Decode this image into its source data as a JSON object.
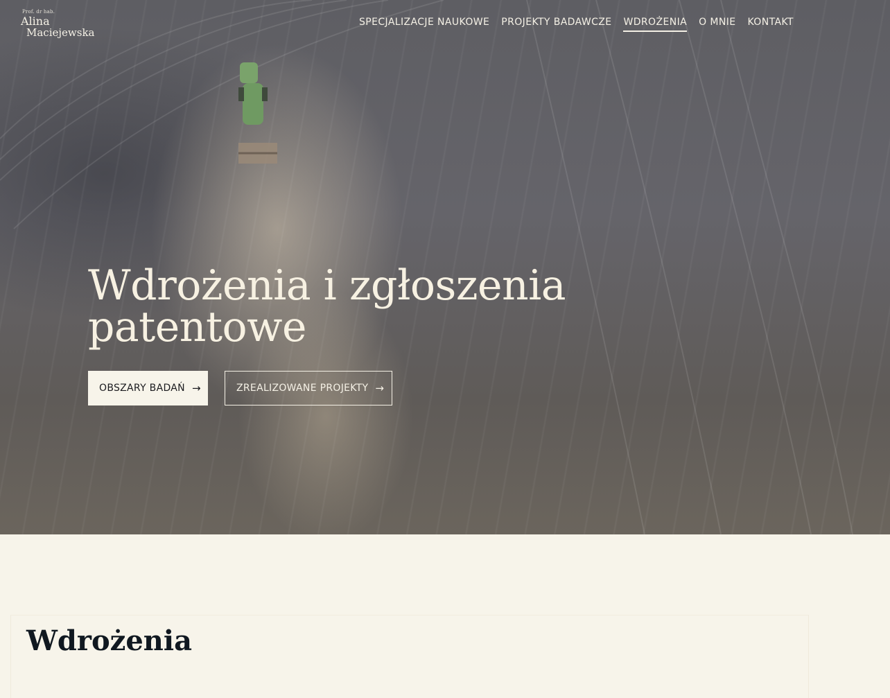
{
  "logo": {
    "prefix": "Prof. dr hab.",
    "first_name": "Alina",
    "last_name": "Maciejewska"
  },
  "nav": {
    "items": [
      {
        "label": "SPECJALIZACJE NAUKOWE",
        "active": false
      },
      {
        "label": "PROJEKTY BADAWCZE",
        "active": false
      },
      {
        "label": "WDROŻENIA",
        "active": true
      },
      {
        "label": "O MNIE",
        "active": false
      },
      {
        "label": "KONTAKT",
        "active": false
      }
    ]
  },
  "hero": {
    "title": "Wdrożenia i zgłoszenia patentowe",
    "primary_button": "OBSZARY BADAŃ",
    "secondary_button": "ZREALIZOWANE PROJEKTY",
    "arrow": "→"
  },
  "section": {
    "title": "Wdrożenia"
  },
  "colors": {
    "cream": "#f7f4ea",
    "dark_text": "#101820",
    "hero_text": "#f7f1e2"
  }
}
